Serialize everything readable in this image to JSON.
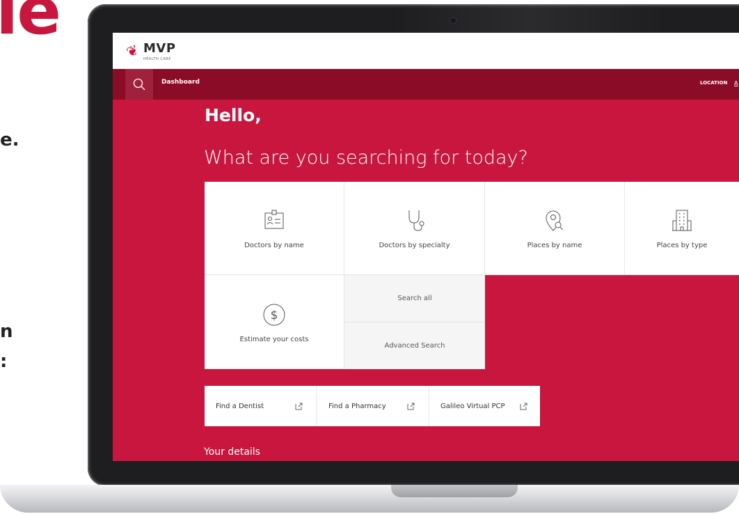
{
  "background_fragments": {
    "big": "le",
    "line_e": "e.",
    "line_n": "n",
    "line_colon": ":"
  },
  "app": {
    "logo": {
      "name": "MVP",
      "sub": "HEALTH CARE"
    },
    "nav": {
      "search_icon": "search-icon",
      "dashboard": "Dashboard",
      "location": "LOCATION",
      "location_value": "A"
    }
  },
  "hero": {
    "greeting": "Hello,",
    "question": "What are you searching for today?"
  },
  "tiles": [
    {
      "label": "Doctors by name",
      "icon": "id-badge-icon"
    },
    {
      "label": "Doctors by specialty",
      "icon": "stethoscope-icon"
    },
    {
      "label": "Places by name",
      "icon": "map-pin-search-icon"
    },
    {
      "label": "Places by type",
      "icon": "building-icon"
    },
    {
      "label": "Estimate your costs",
      "icon": "dollar-circle-icon"
    }
  ],
  "sub_tiles": {
    "search_all": "Search all",
    "advanced": "Advanced Search"
  },
  "links": [
    {
      "label": "Find a Dentist",
      "icon": "external-link-icon"
    },
    {
      "label": "Find a Pharmacy",
      "icon": "external-link-icon"
    },
    {
      "label": "Galileo Virtual PCP",
      "icon": "external-link-icon"
    }
  ],
  "details_heading": "Your details",
  "colors": {
    "brand_red": "#c8163e",
    "nav_dark": "#8b0c27",
    "laptop_bezel": "#1e1e20"
  }
}
